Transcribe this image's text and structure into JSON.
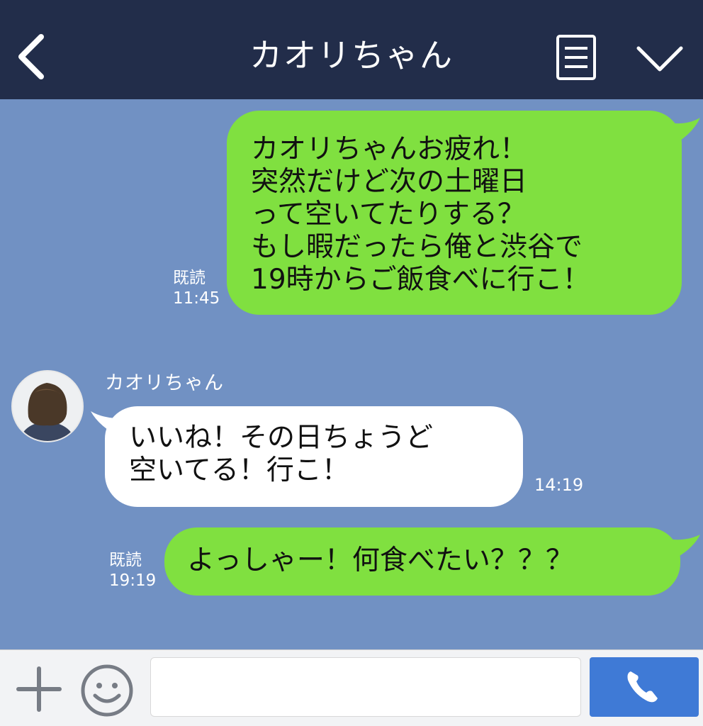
{
  "header": {
    "title": "カオリちゃん",
    "back_icon": "chevron-left-icon",
    "menu_icon": "menu-list-icon",
    "collapse_icon": "chevron-down-icon"
  },
  "messages": [
    {
      "direction": "outgoing",
      "text": "カオリちゃんお疲れ！\n突然だけど次の土曜日\nって空いてたりする？\nもし暇だったら俺と渋谷で\n19時からご飯食べに行こ！",
      "read_label": "既読",
      "time": "11:45"
    },
    {
      "direction": "incoming",
      "sender": "カオリちゃん",
      "text": "いいね！その日ちょうど\n空いてる！行こ！",
      "time": "14:19"
    },
    {
      "direction": "outgoing",
      "text": "よっしゃー！何食べたい？？？",
      "read_label": "既読",
      "time": "19:19"
    }
  ],
  "footer": {
    "plus_icon": "plus-icon",
    "emoji_icon": "smiley-icon",
    "input_value": "",
    "call_icon": "phone-icon"
  },
  "colors": {
    "header_bg": "#222d4a",
    "chat_bg": "#7191c3",
    "outgoing_bubble": "#80e040",
    "incoming_bubble": "#ffffff",
    "call_button": "#3f7ad6"
  }
}
